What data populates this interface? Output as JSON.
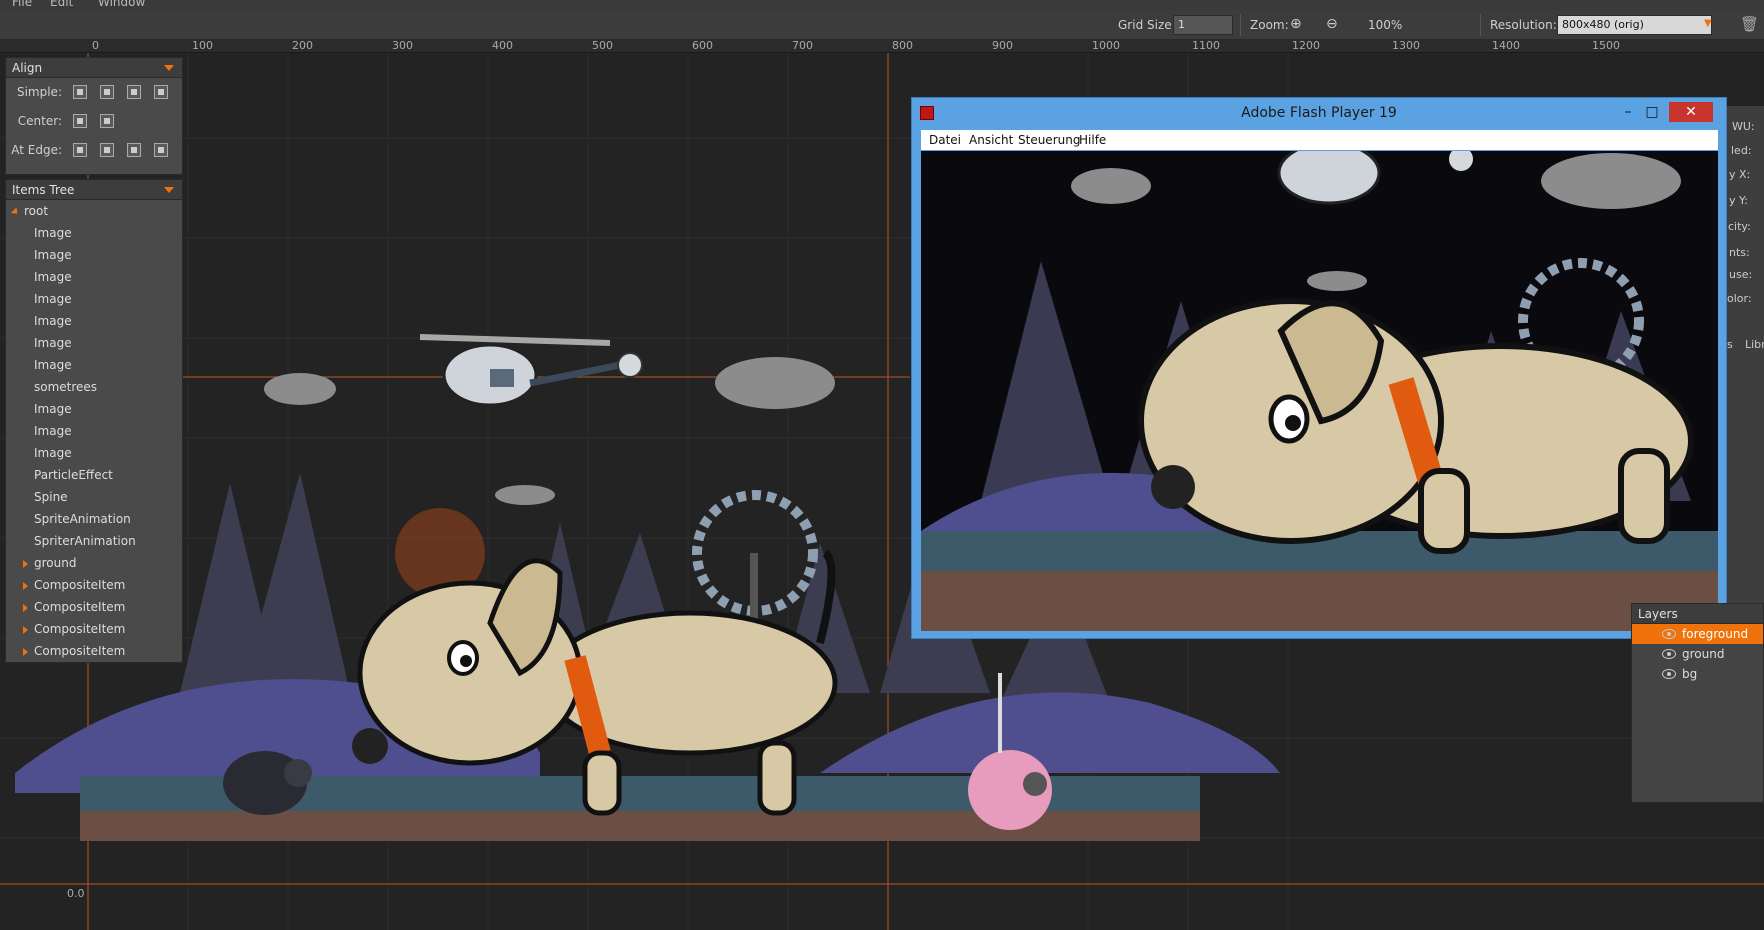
{
  "menu": {
    "file": "File",
    "edit": "Edit",
    "window": "Window"
  },
  "toolbar": {
    "grid_label": "Grid Size:",
    "grid_value": "1",
    "zoom_label": "Zoom:",
    "zoom_value": "100%",
    "resolution_label": "Resolution:",
    "resolution_value": "800x480 (orig)"
  },
  "ruler": {
    "ticks": [
      "0",
      "100",
      "200",
      "300",
      "400",
      "500",
      "600",
      "700",
      "800",
      "900",
      "1000",
      "1100",
      "1200",
      "1300",
      "1400",
      "1500"
    ]
  },
  "origin_label": "0.0",
  "align": {
    "title": "Align",
    "simple": "Simple:",
    "center": "Center:",
    "at_edge": "At Edge:"
  },
  "items_tree": {
    "title": "Items Tree",
    "root": "root",
    "items": [
      {
        "label": "Image",
        "expandable": false
      },
      {
        "label": "Image",
        "expandable": false
      },
      {
        "label": "Image",
        "expandable": false
      },
      {
        "label": "Image",
        "expandable": false
      },
      {
        "label": "Image",
        "expandable": false
      },
      {
        "label": "Image",
        "expandable": false
      },
      {
        "label": "Image",
        "expandable": false
      },
      {
        "label": "sometrees",
        "expandable": false
      },
      {
        "label": "Image",
        "expandable": false
      },
      {
        "label": "Image",
        "expandable": false
      },
      {
        "label": "Image",
        "expandable": false
      },
      {
        "label": "ParticleEffect",
        "expandable": false
      },
      {
        "label": "Spine",
        "expandable": false
      },
      {
        "label": "SpriteAnimation",
        "expandable": false
      },
      {
        "label": "SpriterAnimation",
        "expandable": false
      },
      {
        "label": "ground",
        "expandable": true
      },
      {
        "label": "CompositeItem",
        "expandable": true
      },
      {
        "label": "CompositeItem",
        "expandable": true
      },
      {
        "label": "CompositeItem",
        "expandable": true
      },
      {
        "label": "CompositeItem",
        "expandable": true
      }
    ]
  },
  "flash": {
    "title": "Adobe Flash Player 19",
    "menu": [
      "Datei",
      "Ansicht",
      "Steuerung",
      "Hilfe"
    ]
  },
  "layers": {
    "title": "Layers",
    "items": [
      "foreground",
      "ground",
      "bg"
    ]
  },
  "right_panel": [
    "WU:",
    "led:",
    "y X:",
    "y Y:",
    "city:",
    "nts:",
    "use:",
    "olor:",
    "s",
    "Libr"
  ],
  "colors": {
    "accent": "#f0720a",
    "flash_frame": "#5ba2e2",
    "panel": "#4a4a4a"
  }
}
